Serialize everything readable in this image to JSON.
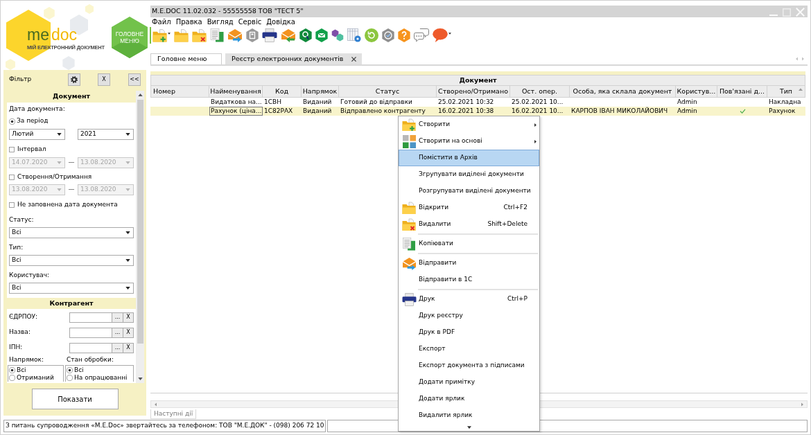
{
  "logo": {
    "wordmark": [
      "me",
      "doc"
    ],
    "tagline": "МІЙ ЕЛЕКТРОННИЙ ДОКУМЕНТ"
  },
  "main_menu_button": {
    "label": "ГОЛОВНЕ МЕНЮ"
  },
  "filter": {
    "title": "Фільтр",
    "clear_button": "X",
    "collapse_button": "<<",
    "document": {
      "title": "Документ",
      "date_label": "Дата документа:",
      "period": {
        "label": "За період",
        "selected": true,
        "month": "Лютий",
        "year": "2021"
      },
      "ranges": [
        {
          "label": "Інтервал",
          "checked": false,
          "disabled": true,
          "from": "14.07.2020",
          "separator": "—",
          "to": "13.08.2020"
        },
        {
          "label": "Створення/Отримання",
          "checked": false,
          "disabled": true,
          "from": "13.08.2020",
          "separator": "—",
          "to": "13.08.2020"
        }
      ],
      "empty_date": {
        "label": "Не заповнена дата документа",
        "checked": false
      },
      "selects": [
        {
          "label": "Статус:",
          "value": "Всі"
        },
        {
          "label": "Тип:",
          "value": "Всі"
        },
        {
          "label": "Користувач:",
          "value": "Всі"
        }
      ]
    },
    "counterparty": {
      "title": "Контрагент",
      "fields": [
        {
          "label": "ЄДРПОУ:",
          "browse": "...",
          "clear": "X"
        },
        {
          "label": "Назва:",
          "browse": "...",
          "clear": "X"
        },
        {
          "label": "ІПН:",
          "browse": "...",
          "clear": "X"
        }
      ],
      "groups": [
        {
          "label": "Напрямок:",
          "options": [
            {
              "label": "Всі",
              "selected": true
            },
            {
              "label": "Отриманий",
              "selected": false
            }
          ]
        },
        {
          "label": "Стан обробки:",
          "options": [
            {
              "label": "Всі",
              "selected": true
            },
            {
              "label": "На опрацюванні",
              "selected": false
            }
          ]
        }
      ]
    },
    "show_button": "Показати"
  },
  "window": {
    "title": "M.E.DOC 11.02.032 - 55555558 ТОВ \"ТЕСТ 5\""
  },
  "menu": [
    "Файл",
    "Правка",
    "Вигляд",
    "Сервіс",
    "Довідка"
  ],
  "tabs": [
    {
      "label": "Головне меню",
      "selected": false,
      "closable": false
    },
    {
      "label": "Реєстр електронних документів",
      "selected": true,
      "closable": true
    }
  ],
  "table": {
    "group_header": "Документ",
    "columns": [
      {
        "label": "Номер",
        "sorted": false
      },
      {
        "label": "Найменування",
        "sorted": false
      },
      {
        "label": "Код",
        "sorted": false
      },
      {
        "label": "Напрямок",
        "sorted": false
      },
      {
        "label": "Статус",
        "sorted": false
      },
      {
        "label": "Створено/Отримано",
        "sorted": false
      },
      {
        "label": "Ост. опер.",
        "sorted": false
      },
      {
        "label": "Особа, яка склала документ",
        "sorted": false
      },
      {
        "label": "Користув...",
        "sorted": false
      },
      {
        "label": "Пов'язані д...",
        "sorted": false
      },
      {
        "label": "Тип",
        "sorted": true
      }
    ],
    "rows": [
      {
        "selected": false,
        "cells": [
          {
            "kind": "text",
            "focused": false
          },
          {
            "kind": "text",
            "text": "Видаткова на...",
            "focused": false
          },
          {
            "kind": "text",
            "text": "1СВН",
            "focused": false
          },
          {
            "kind": "text",
            "text": "Виданий",
            "focused": false
          },
          {
            "kind": "text",
            "text": "Готовий до відправки",
            "focused": false
          },
          {
            "kind": "text",
            "text": "25.02.2021 10:32",
            "focused": false
          },
          {
            "kind": "text",
            "text": "25.02.2021 10...",
            "focused": false
          },
          {
            "kind": "text",
            "focused": false
          },
          {
            "kind": "text",
            "text": "Admin",
            "focused": false
          },
          {
            "kind": "check",
            "checked": false,
            "focused": false
          },
          {
            "kind": "text",
            "text": "Накладна",
            "focused": false
          }
        ]
      },
      {
        "selected": true,
        "cells": [
          {
            "kind": "text",
            "focused": false
          },
          {
            "kind": "text",
            "text": "Рахунок (ціна...",
            "focused": true
          },
          {
            "kind": "text",
            "text": "1С82РАХ",
            "focused": false
          },
          {
            "kind": "text",
            "text": "Виданий",
            "focused": false
          },
          {
            "kind": "text",
            "text": "Відправлено контрагенту",
            "focused": false
          },
          {
            "kind": "text",
            "text": "16.02.2021 10:38",
            "focused": false
          },
          {
            "kind": "text",
            "text": "16.02.2021 10...",
            "focused": false
          },
          {
            "kind": "text",
            "text": "КАРПОВ ІВАН МИКОЛАЙОВИЧ",
            "focused": false
          },
          {
            "kind": "text",
            "text": "Admin",
            "focused": false
          },
          {
            "kind": "check",
            "checked": true,
            "focused": false
          },
          {
            "kind": "text",
            "text": "Рахунок",
            "focused": false
          }
        ]
      }
    ]
  },
  "context_menu": {
    "items": [
      {
        "kind": "new",
        "label": "Створити",
        "submenu": true,
        "selected": false
      },
      {
        "kind": "derive",
        "label": "Створити на основі",
        "submenu": true,
        "selected": false
      },
      {
        "kind": "plain",
        "label": "Помістити в Архів",
        "submenu": false,
        "selected": true
      },
      {
        "kind": "plain",
        "label": "Згрупувати виділені документи",
        "submenu": false,
        "selected": false
      },
      {
        "kind": "plain",
        "label": "Розгрупувати виділені документи",
        "submenu": false,
        "selected": false
      },
      {
        "kind": "open",
        "label": "Відкрити",
        "shortcut": "Ctrl+F2",
        "submenu": false,
        "selected": false
      },
      {
        "kind": "delete",
        "label": "Видалити",
        "shortcut": "Shift+Delete",
        "submenu": false,
        "selected": false
      },
      {
        "kind": "separator"
      },
      {
        "kind": "copy",
        "label": "Копіювати",
        "submenu": false,
        "selected": false
      },
      {
        "kind": "separator"
      },
      {
        "kind": "send",
        "label": "Відправити",
        "submenu": false,
        "selected": false
      },
      {
        "kind": "plain",
        "label": "Відправити в 1С",
        "submenu": false,
        "selected": false
      },
      {
        "kind": "separator"
      },
      {
        "kind": "print",
        "label": "Друк",
        "shortcut": "Ctrl+P",
        "submenu": false,
        "selected": false
      },
      {
        "kind": "plain",
        "label": "Друк реєстру",
        "submenu": false,
        "selected": false
      },
      {
        "kind": "plain",
        "label": "Друк в PDF",
        "submenu": false,
        "selected": false
      },
      {
        "kind": "plain",
        "label": "Експорт",
        "submenu": false,
        "selected": false
      },
      {
        "kind": "plain",
        "label": "Експорт документа з підписами",
        "submenu": false,
        "selected": false
      },
      {
        "kind": "plain",
        "label": "Додати примітку",
        "submenu": false,
        "selected": false
      },
      {
        "kind": "plain",
        "label": "Додати ярлик",
        "submenu": false,
        "selected": false
      },
      {
        "kind": "plain",
        "label": "Видалити ярлик",
        "submenu": false,
        "selected": false
      }
    ]
  },
  "next_actions_tab": "Наступні дії",
  "status_bar": {
    "message": "З питань супроводження «M.E.Doc» звертайтесь за телефоном: ТОВ \"М.Е.ДОК\" - (098) 206 72 10"
  }
}
